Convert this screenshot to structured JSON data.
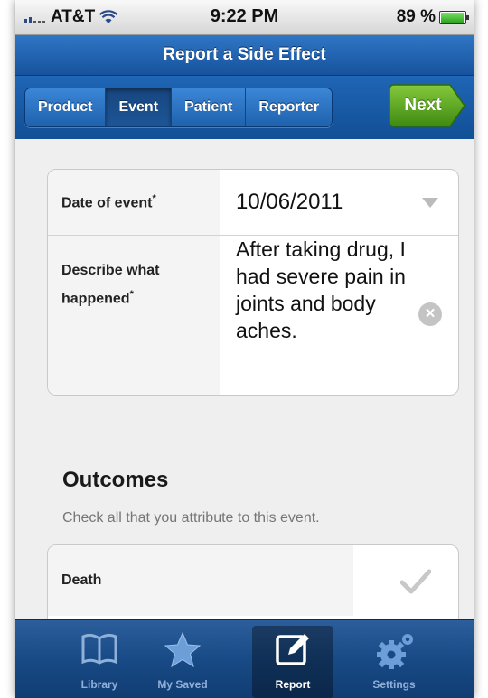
{
  "status_bar": {
    "carrier": "AT&T",
    "time": "9:22 PM",
    "battery": "89 %"
  },
  "nav": {
    "title": "Report a Side Effect"
  },
  "segments": [
    {
      "label": "Product",
      "active": false
    },
    {
      "label": "Event",
      "active": true
    },
    {
      "label": "Patient",
      "active": false
    },
    {
      "label": "Reporter",
      "active": false
    }
  ],
  "next_label": "Next",
  "form": {
    "date_label": "Date of event",
    "date_required": "*",
    "date_value": "10/06/2011",
    "describe_label": "Describe what happened",
    "describe_required": "*",
    "describe_value": "After taking drug, I had severe pain in joints and body aches."
  },
  "outcomes": {
    "title": "Outcomes",
    "subtitle": "Check all that you attribute to this event.",
    "items": [
      {
        "label": "Death"
      }
    ]
  },
  "tabbar": {
    "items": [
      {
        "label": "Library",
        "icon": "book-icon"
      },
      {
        "label": "My Saved",
        "icon": "star-icon"
      },
      {
        "label": "Report",
        "icon": "edit-icon"
      },
      {
        "label": "Settings",
        "icon": "gear-icon"
      }
    ],
    "active": "Report"
  },
  "colors": {
    "nav_blue": "#17529d",
    "next_green": "#4f9e1a",
    "tab_bar": "#184a86"
  }
}
